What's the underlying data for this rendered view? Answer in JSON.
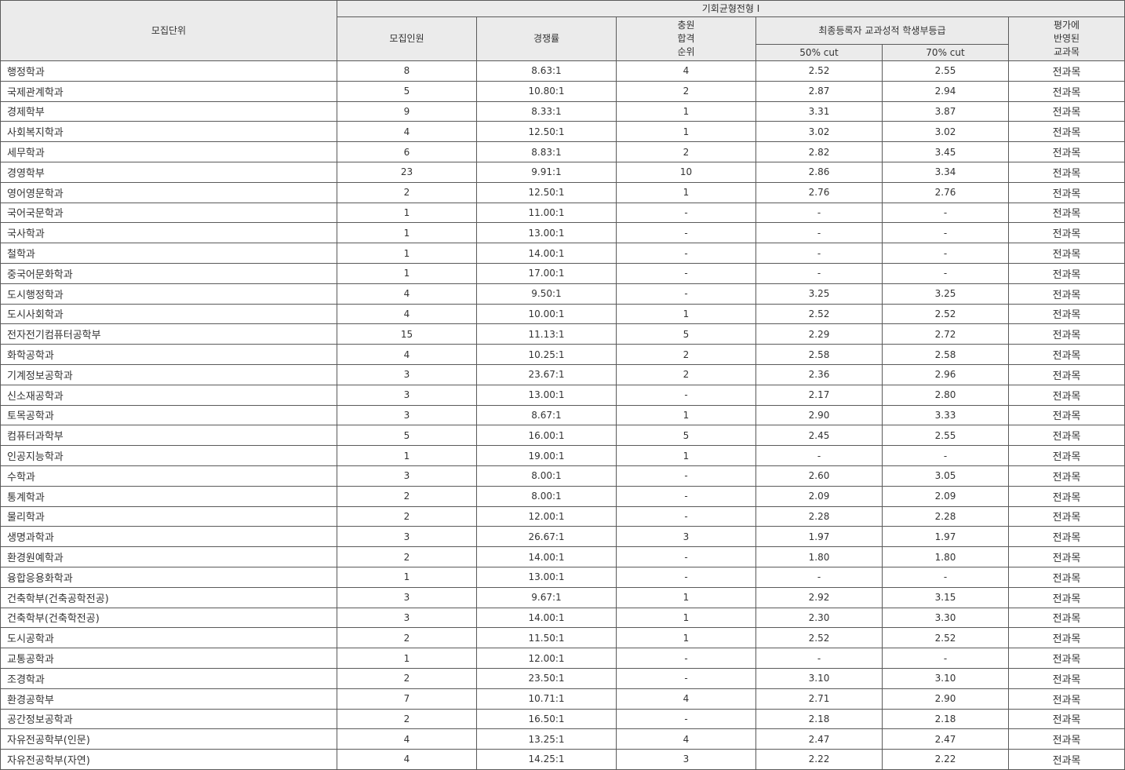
{
  "header": {
    "unit": "모집단위",
    "program": "기회균형전형 I",
    "quota": "모집인원",
    "competition": "경쟁률",
    "rank": [
      "충원",
      "합격",
      "순위"
    ],
    "grade_group": "최종등록자 교과성적 학생부등급",
    "cut50": "50% cut",
    "cut70": "70% cut",
    "subjects": [
      "평가에",
      "반영된",
      "교과목"
    ]
  },
  "rows": [
    {
      "unit": "행정학과",
      "quota": "8",
      "rate": "8.63:1",
      "rank": "4",
      "cut50": "2.52",
      "cut70": "2.55",
      "subjects": "전과목"
    },
    {
      "unit": "국제관계학과",
      "quota": "5",
      "rate": "10.80:1",
      "rank": "2",
      "cut50": "2.87",
      "cut70": "2.94",
      "subjects": "전과목"
    },
    {
      "unit": "경제학부",
      "quota": "9",
      "rate": "8.33:1",
      "rank": "1",
      "cut50": "3.31",
      "cut70": "3.87",
      "subjects": "전과목"
    },
    {
      "unit": "사회복지학과",
      "quota": "4",
      "rate": "12.50:1",
      "rank": "1",
      "cut50": "3.02",
      "cut70": "3.02",
      "subjects": "전과목"
    },
    {
      "unit": "세무학과",
      "quota": "6",
      "rate": "8.83:1",
      "rank": "2",
      "cut50": "2.82",
      "cut70": "3.45",
      "subjects": "전과목"
    },
    {
      "unit": "경영학부",
      "quota": "23",
      "rate": "9.91:1",
      "rank": "10",
      "cut50": "2.86",
      "cut70": "3.34",
      "subjects": "전과목"
    },
    {
      "unit": "영어영문학과",
      "quota": "2",
      "rate": "12.50:1",
      "rank": "1",
      "cut50": "2.76",
      "cut70": "2.76",
      "subjects": "전과목"
    },
    {
      "unit": "국어국문학과",
      "quota": "1",
      "rate": "11.00:1",
      "rank": "-",
      "cut50": "-",
      "cut70": "-",
      "subjects": "전과목"
    },
    {
      "unit": "국사학과",
      "quota": "1",
      "rate": "13.00:1",
      "rank": "-",
      "cut50": "-",
      "cut70": "-",
      "subjects": "전과목"
    },
    {
      "unit": "철학과",
      "quota": "1",
      "rate": "14.00:1",
      "rank": "-",
      "cut50": "-",
      "cut70": "-",
      "subjects": "전과목"
    },
    {
      "unit": "중국어문화학과",
      "quota": "1",
      "rate": "17.00:1",
      "rank": "-",
      "cut50": "-",
      "cut70": "-",
      "subjects": "전과목"
    },
    {
      "unit": "도시행정학과",
      "quota": "4",
      "rate": "9.50:1",
      "rank": "-",
      "cut50": "3.25",
      "cut70": "3.25",
      "subjects": "전과목"
    },
    {
      "unit": "도시사회학과",
      "quota": "4",
      "rate": "10.00:1",
      "rank": "1",
      "cut50": "2.52",
      "cut70": "2.52",
      "subjects": "전과목"
    },
    {
      "unit": "전자전기컴퓨터공학부",
      "quota": "15",
      "rate": "11.13:1",
      "rank": "5",
      "cut50": "2.29",
      "cut70": "2.72",
      "subjects": "전과목"
    },
    {
      "unit": "화학공학과",
      "quota": "4",
      "rate": "10.25:1",
      "rank": "2",
      "cut50": "2.58",
      "cut70": "2.58",
      "subjects": "전과목"
    },
    {
      "unit": "기계정보공학과",
      "quota": "3",
      "rate": "23.67:1",
      "rank": "2",
      "cut50": "2.36",
      "cut70": "2.96",
      "subjects": "전과목"
    },
    {
      "unit": "신소재공학과",
      "quota": "3",
      "rate": "13.00:1",
      "rank": "-",
      "cut50": "2.17",
      "cut70": "2.80",
      "subjects": "전과목"
    },
    {
      "unit": "토목공학과",
      "quota": "3",
      "rate": "8.67:1",
      "rank": "1",
      "cut50": "2.90",
      "cut70": "3.33",
      "subjects": "전과목"
    },
    {
      "unit": "컴퓨터과학부",
      "quota": "5",
      "rate": "16.00:1",
      "rank": "5",
      "cut50": "2.45",
      "cut70": "2.55",
      "subjects": "전과목"
    },
    {
      "unit": "인공지능학과",
      "quota": "1",
      "rate": "19.00:1",
      "rank": "1",
      "cut50": "-",
      "cut70": "-",
      "subjects": "전과목"
    },
    {
      "unit": "수학과",
      "quota": "3",
      "rate": "8.00:1",
      "rank": "-",
      "cut50": "2.60",
      "cut70": "3.05",
      "subjects": "전과목"
    },
    {
      "unit": "통계학과",
      "quota": "2",
      "rate": "8.00:1",
      "rank": "-",
      "cut50": "2.09",
      "cut70": "2.09",
      "subjects": "전과목"
    },
    {
      "unit": "물리학과",
      "quota": "2",
      "rate": "12.00:1",
      "rank": "-",
      "cut50": "2.28",
      "cut70": "2.28",
      "subjects": "전과목"
    },
    {
      "unit": "생명과학과",
      "quota": "3",
      "rate": "26.67:1",
      "rank": "3",
      "cut50": "1.97",
      "cut70": "1.97",
      "subjects": "전과목"
    },
    {
      "unit": "환경원예학과",
      "quota": "2",
      "rate": "14.00:1",
      "rank": "-",
      "cut50": "1.80",
      "cut70": "1.80",
      "subjects": "전과목"
    },
    {
      "unit": "융합응용화학과",
      "quota": "1",
      "rate": "13.00:1",
      "rank": "-",
      "cut50": "-",
      "cut70": "-",
      "subjects": "전과목"
    },
    {
      "unit": "건축학부(건축공학전공)",
      "quota": "3",
      "rate": "9.67:1",
      "rank": "1",
      "cut50": "2.92",
      "cut70": "3.15",
      "subjects": "전과목"
    },
    {
      "unit": "건축학부(건축학전공)",
      "quota": "3",
      "rate": "14.00:1",
      "rank": "1",
      "cut50": "2.30",
      "cut70": "3.30",
      "subjects": "전과목"
    },
    {
      "unit": "도시공학과",
      "quota": "2",
      "rate": "11.50:1",
      "rank": "1",
      "cut50": "2.52",
      "cut70": "2.52",
      "subjects": "전과목"
    },
    {
      "unit": "교통공학과",
      "quota": "1",
      "rate": "12.00:1",
      "rank": "-",
      "cut50": "-",
      "cut70": "-",
      "subjects": "전과목"
    },
    {
      "unit": "조경학과",
      "quota": "2",
      "rate": "23.50:1",
      "rank": "-",
      "cut50": "3.10",
      "cut70": "3.10",
      "subjects": "전과목"
    },
    {
      "unit": "환경공학부",
      "quota": "7",
      "rate": "10.71:1",
      "rank": "4",
      "cut50": "2.71",
      "cut70": "2.90",
      "subjects": "전과목"
    },
    {
      "unit": "공간정보공학과",
      "quota": "2",
      "rate": "16.50:1",
      "rank": "-",
      "cut50": "2.18",
      "cut70": "2.18",
      "subjects": "전과목"
    },
    {
      "unit": "자유전공학부(인문)",
      "quota": "4",
      "rate": "13.25:1",
      "rank": "4",
      "cut50": "2.47",
      "cut70": "2.47",
      "subjects": "전과목"
    },
    {
      "unit": "자유전공학부(자연)",
      "quota": "4",
      "rate": "14.25:1",
      "rank": "3",
      "cut50": "2.22",
      "cut70": "2.22",
      "subjects": "전과목"
    }
  ]
}
